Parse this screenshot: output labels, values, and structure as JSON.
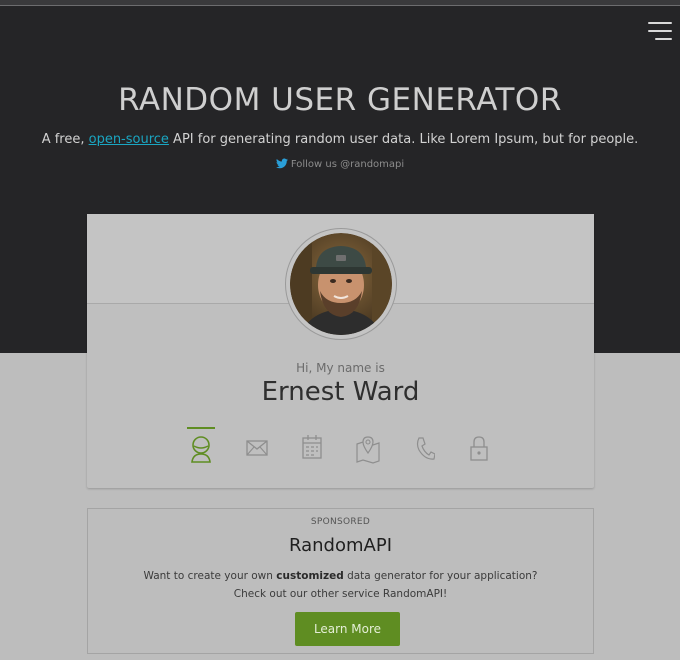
{
  "header": {
    "title": "RANDOM USER GENERATOR",
    "subtitle_prefix": "A free, ",
    "subtitle_link": "open-source",
    "subtitle_suffix": " API for generating random user data. Like Lorem Ipsum, but for people.",
    "twitter_text": "Follow us @randomapi",
    "menu_icon": "hamburger-icon"
  },
  "profile": {
    "greeting": "Hi, My name is",
    "name": "Ernest Ward",
    "photo_icon": "user-photo",
    "tabs": [
      {
        "icon": "user-icon",
        "active": true
      },
      {
        "icon": "mail-icon",
        "active": false
      },
      {
        "icon": "calendar-icon",
        "active": false
      },
      {
        "icon": "map-icon",
        "active": false
      },
      {
        "icon": "phone-icon",
        "active": false
      },
      {
        "icon": "lock-icon",
        "active": false
      }
    ]
  },
  "sponsored": {
    "label": "SPONSORED",
    "title": "RandomAPI",
    "line1_prefix": "Want to create your own ",
    "line1_bold": "customized",
    "line1_suffix": " data generator for your application?",
    "line2": "Check out our other service RandomAPI!",
    "button": "Learn More"
  },
  "colors": {
    "hero_bg": "#252527",
    "page_bg": "#bdbdbd",
    "accent_green": "#5f8d22",
    "link_blue": "#1aa6c2"
  }
}
